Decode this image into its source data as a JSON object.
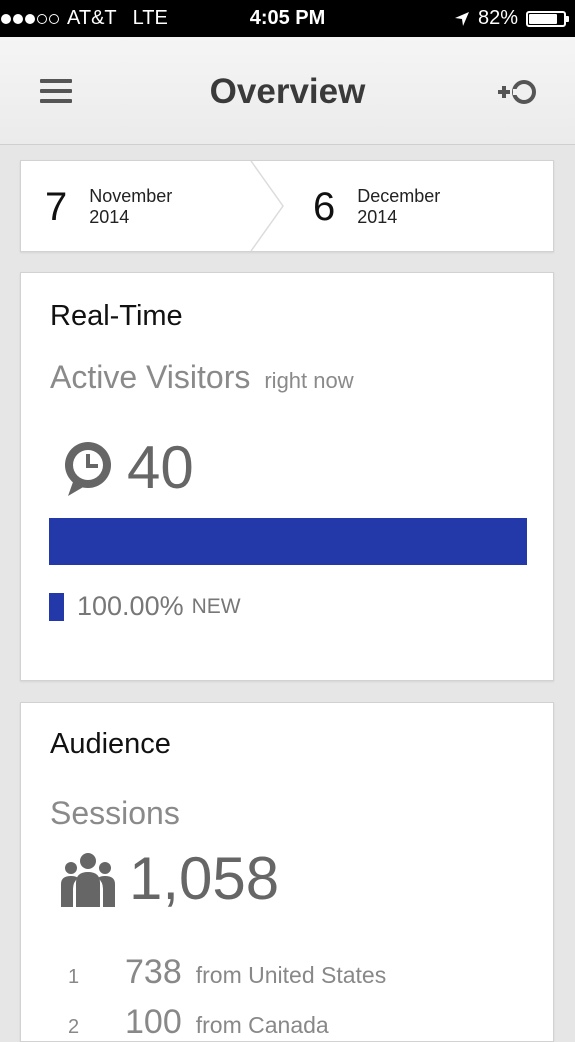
{
  "status_bar": {
    "signal_bars_filled": 3,
    "signal_bars_total": 5,
    "carrier": "AT&T",
    "network": "LTE",
    "time": "4:05 PM",
    "battery": "82%",
    "battery_level": 0.82,
    "icons": [
      "signal-dots",
      "location-arrow",
      "battery"
    ]
  },
  "nav": {
    "title": "Overview",
    "icons": [
      "hamburger-menu",
      "add-segment"
    ]
  },
  "date_range": {
    "start": {
      "day": "7",
      "month": "November",
      "year": "2014"
    },
    "end": {
      "day": "6",
      "month": "December",
      "year": "2014"
    }
  },
  "realtime": {
    "title": "Real-Time",
    "metric_label": "Active Visitors",
    "metric_sub": "right now",
    "value": "40",
    "icon": "clock-bubble",
    "bar_fraction": 1.0,
    "legend_pct": "100.00%",
    "legend_label": "NEW",
    "color": "#2339a9"
  },
  "audience": {
    "title": "Audience",
    "metric_label": "Sessions",
    "value": "1,058",
    "icon": "people-group",
    "countries": [
      {
        "rank": "1",
        "count": "738",
        "from": "from United States"
      },
      {
        "rank": "2",
        "count": "100",
        "from": "from Canada"
      }
    ]
  }
}
